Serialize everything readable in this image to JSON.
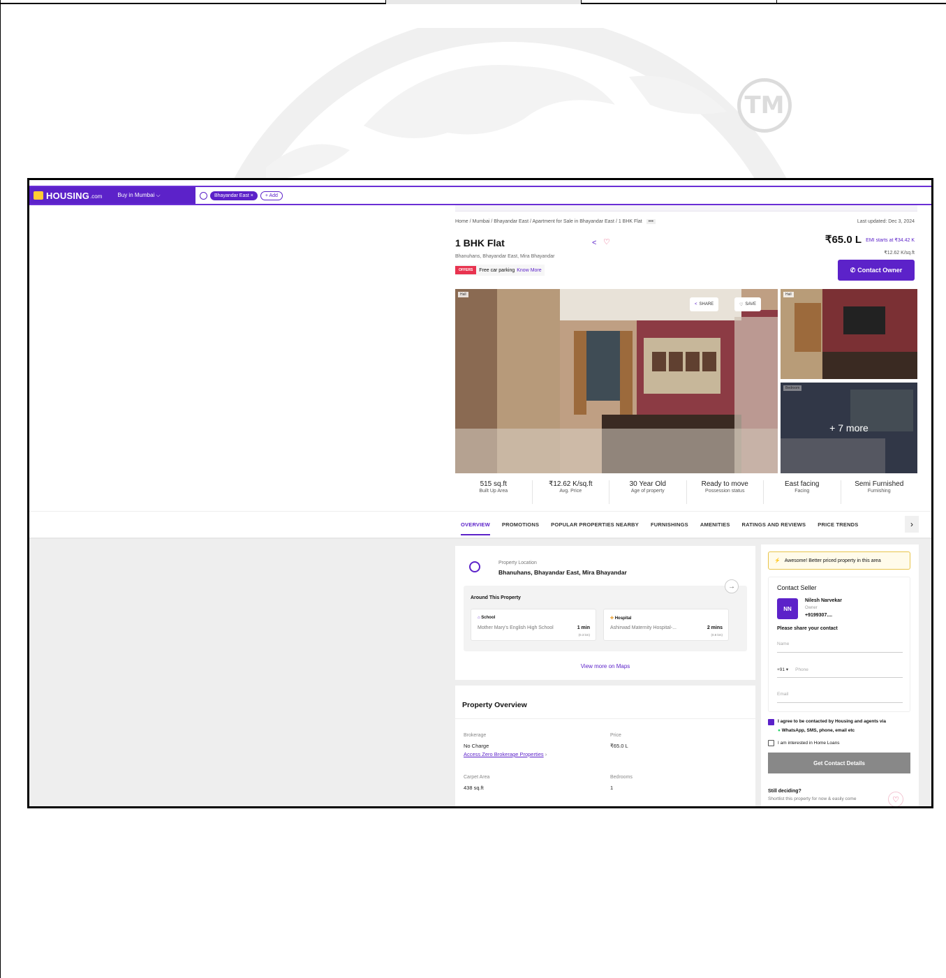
{
  "navbar": {
    "logo_text": "HOUSING",
    "logo_suffix": ".com",
    "buy_label": "Buy in Mumbai ⌵",
    "search_chip": "Bhayandar East ×",
    "add_chip": "+ Add"
  },
  "watermark": {
    "tm": "TM"
  },
  "breadcrumb": "Home / Mumbai / Bhayandar East / Apartment for Sale in Bhayandar East / 1 BHK Flat",
  "breadcrumb_more": "•••",
  "last_updated": "Last updated: Dec 3, 2024",
  "property": {
    "title": "1 BHK Flat",
    "address": "Bhanuhans, Bhayandar East, Mira Bhayandar",
    "price": "₹65.0 L",
    "emi": "EMI starts at ₹34.42 K",
    "price_per_sqft": "₹12.62 K/sq.ft",
    "offers_badge": "OFFERS",
    "offer_text": "Free car parking",
    "offer_link": "Know More",
    "contact_owner": "Contact Owner"
  },
  "photos": {
    "main_tag": "Hall",
    "side1_tag": "Hall",
    "side2_tag": "Bedroom",
    "share": "SHARE",
    "save": "SAVE",
    "more": "+ 7 more"
  },
  "stats": [
    {
      "value": "515 sq.ft",
      "label": "Built Up Area"
    },
    {
      "value": "₹12.62 K/sq.ft",
      "label": "Avg. Price"
    },
    {
      "value": "30 Year Old",
      "label": "Age of property"
    },
    {
      "value": "Ready to move",
      "label": "Possession status"
    },
    {
      "value": "East facing",
      "label": "Facing"
    },
    {
      "value": "Semi Furnished",
      "label": "Furnishing"
    }
  ],
  "tabs": [
    "OVERVIEW",
    "PROMOTIONS",
    "POPULAR PROPERTIES NEARBY",
    "FURNISHINGS",
    "AMENITIES",
    "RATINGS AND REVIEWS",
    "PRICE TRENDS"
  ],
  "location": {
    "label": "Property Location",
    "value": "Bhanuhans, Bhayandar East, Mira Bhayandar",
    "around_title": "Around This Property",
    "pois": [
      {
        "type": "School",
        "name": "Mother Mary's English High School",
        "time": "1 min",
        "dist": "(0.3 km)"
      },
      {
        "type": "Hospital",
        "name": "Ashirwad Maternity Hospital-...",
        "time": "2 mins",
        "dist": "(0.8 km)"
      }
    ],
    "maps_link": "View more on Maps"
  },
  "overview": {
    "title": "Property Overview",
    "brokerage_label": "Brokerage",
    "brokerage_value": "No Charge",
    "brokerage_link": "Access Zero Brokerage Properties",
    "price_label": "Price",
    "price_value": "₹65.0 L",
    "carpet_label": "Carpet Area",
    "carpet_value": "438 sq.ft",
    "bedrooms_label": "Bedrooms",
    "bedrooms_value": "1"
  },
  "seller": {
    "awesome": "Awesome! Better priced property in this area",
    "title": "Contact Seller",
    "initials": "NN",
    "name": "Nilesh Narvekar",
    "role": "Owner",
    "phone": "+9199307....",
    "share_prompt": "Please share your contact",
    "name_placeholder": "Name",
    "country_code": "+91 ▾",
    "phone_placeholder": "Phone",
    "email_placeholder": "Email",
    "agree_text": "I agree to be contacted by Housing and agents via",
    "agree_text2": "WhatsApp, SMS, phone, email etc",
    "loans_text": "I am interested in Home Loans",
    "get_contact": "Get Contact Details",
    "still_deciding": "Still deciding?",
    "shortlist": "Shortlist this property for now & easily come"
  }
}
